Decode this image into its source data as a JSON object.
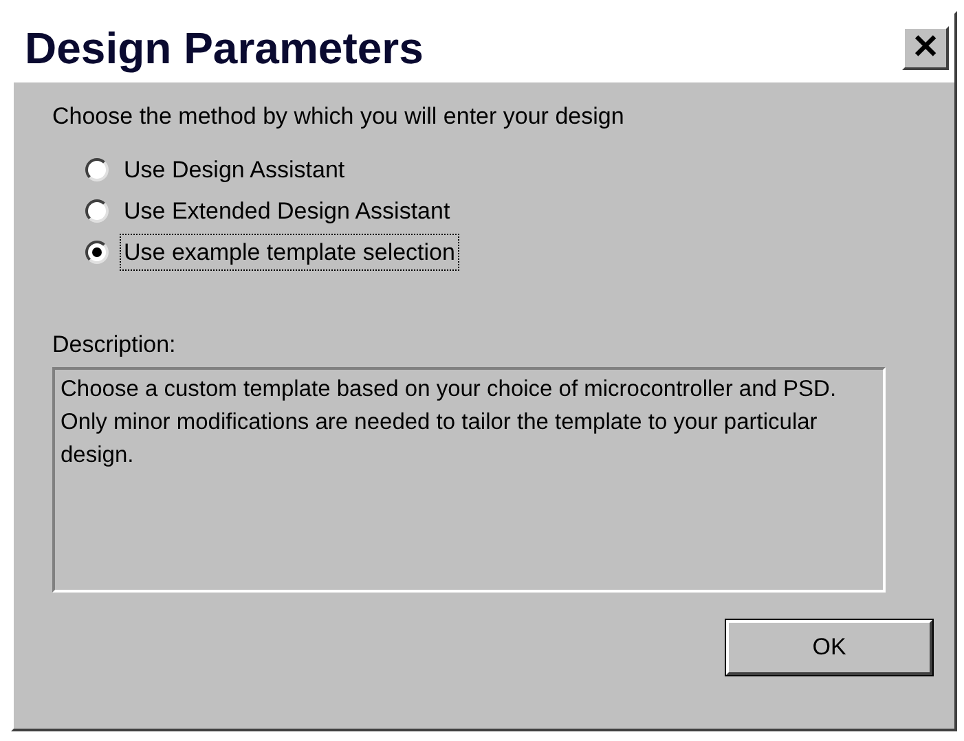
{
  "window": {
    "title": "Design Parameters",
    "close": "✕"
  },
  "prompt": "Choose the method by which you will enter your design",
  "options": [
    {
      "label": "Use Design Assistant",
      "selected": false
    },
    {
      "label": "Use Extended Design Assistant",
      "selected": false
    },
    {
      "label": "Use example template selection",
      "selected": true
    }
  ],
  "description": {
    "label": "Description:",
    "text": "Choose a custom template based on your choice of microcontroller and PSD. Only minor modifications are needed to tailor the template to your particular design."
  },
  "buttons": [
    "OK"
  ]
}
